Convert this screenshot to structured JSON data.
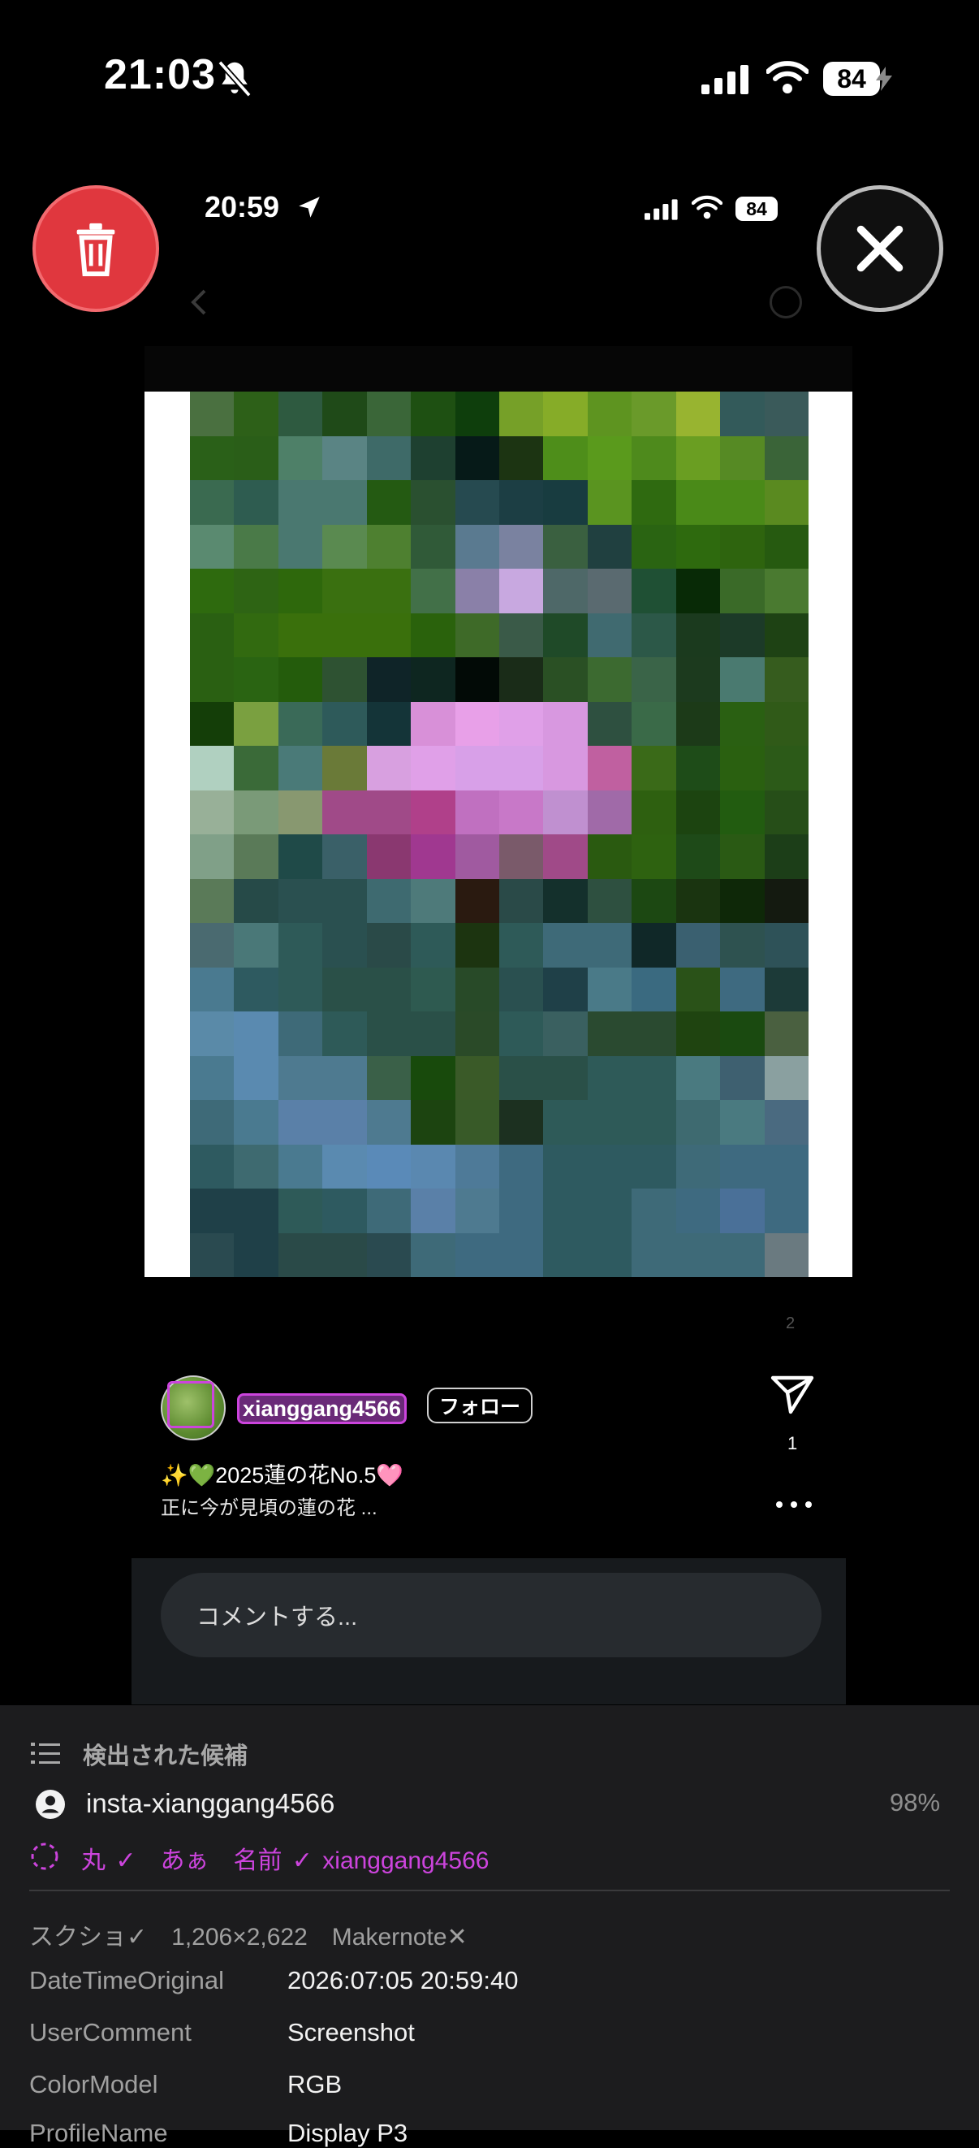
{
  "status_bar": {
    "time": "21:03",
    "battery": "84"
  },
  "inner_status_bar": {
    "time": "20:59",
    "battery": "84"
  },
  "post": {
    "page_indicator": "2",
    "username": "xianggang4566",
    "follow_label": "フォロー",
    "caption_title": "✨💚2025蓮の花No.5🩷",
    "caption_text": "正に今が見頃の蓮の花 ...",
    "share_count": "1",
    "comment_placeholder": "コメントする..."
  },
  "panel": {
    "title": "検出された候補",
    "candidate": "insta-xianggang4566",
    "confidence": "98%",
    "tags": "丸 ✓　あぁ　名前 ✓ xianggang4566",
    "summary": "スクショ✓　1,206×2,622　Makernote✕",
    "rows": [
      {
        "key": "DateTimeOriginal",
        "value": "2026:07:05 20:59:40"
      },
      {
        "key": "UserComment",
        "value": "Screenshot"
      },
      {
        "key": "ColorModel",
        "value": "RGB"
      },
      {
        "key": "ProfileName",
        "value": "Display P3"
      }
    ]
  },
  "colors": {
    "trash": "#e0373e",
    "highlight": "#cc44dd",
    "panel_bg": "#1c1c1e"
  }
}
